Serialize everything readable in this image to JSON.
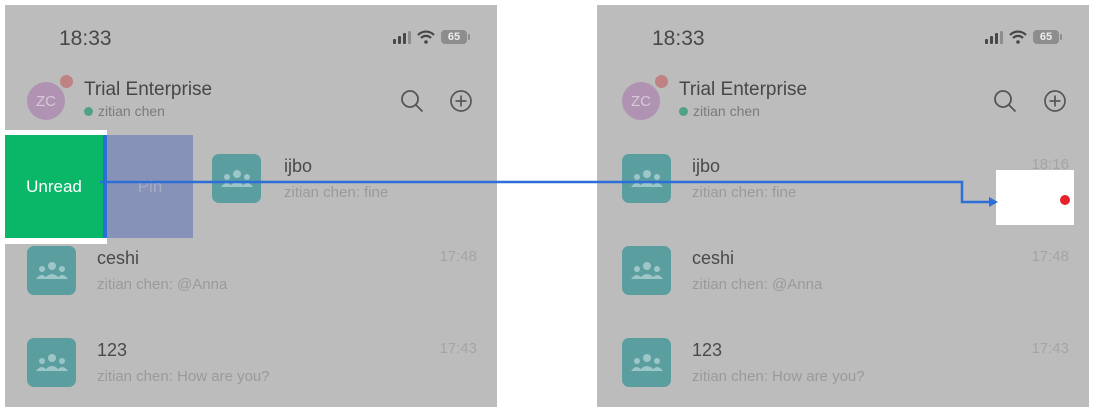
{
  "left": {
    "status_time": "18:33",
    "battery": "65",
    "header": {
      "org_name": "Trial Enterprise",
      "avatar_initials": "ZC",
      "user_name": "zitian chen"
    },
    "swipe_actions": {
      "unread_label": "Unread",
      "pin_label": "Pin"
    },
    "chats": [
      {
        "name": "ijbo",
        "preview": "zitian chen: fine",
        "time": ""
      },
      {
        "name": "ceshi",
        "preview": "zitian chen: @Anna",
        "time": "17:48"
      },
      {
        "name": "123",
        "preview": "zitian chen: How are you?",
        "time": "17:43"
      }
    ]
  },
  "right": {
    "status_time": "18:33",
    "battery": "65",
    "header": {
      "org_name": "Trial Enterprise",
      "avatar_initials": "ZC",
      "user_name": "zitian chen"
    },
    "chats": [
      {
        "name": "ijbo",
        "preview": "zitian chen: fine",
        "time": "18:16"
      },
      {
        "name": "ceshi",
        "preview": "zitian chen: @Anna",
        "time": "17:48"
      },
      {
        "name": "123",
        "preview": "zitian chen: How are you?",
        "time": "17:43"
      }
    ]
  },
  "colors": {
    "unread_action": "#0ab769",
    "pin_action": "#8692b7",
    "annotation_arrow": "#2d6fd6",
    "unread_dot": "#e8222a"
  },
  "icons": {
    "search": "search-icon",
    "add": "plus-circle-icon",
    "group": "group-icon"
  }
}
